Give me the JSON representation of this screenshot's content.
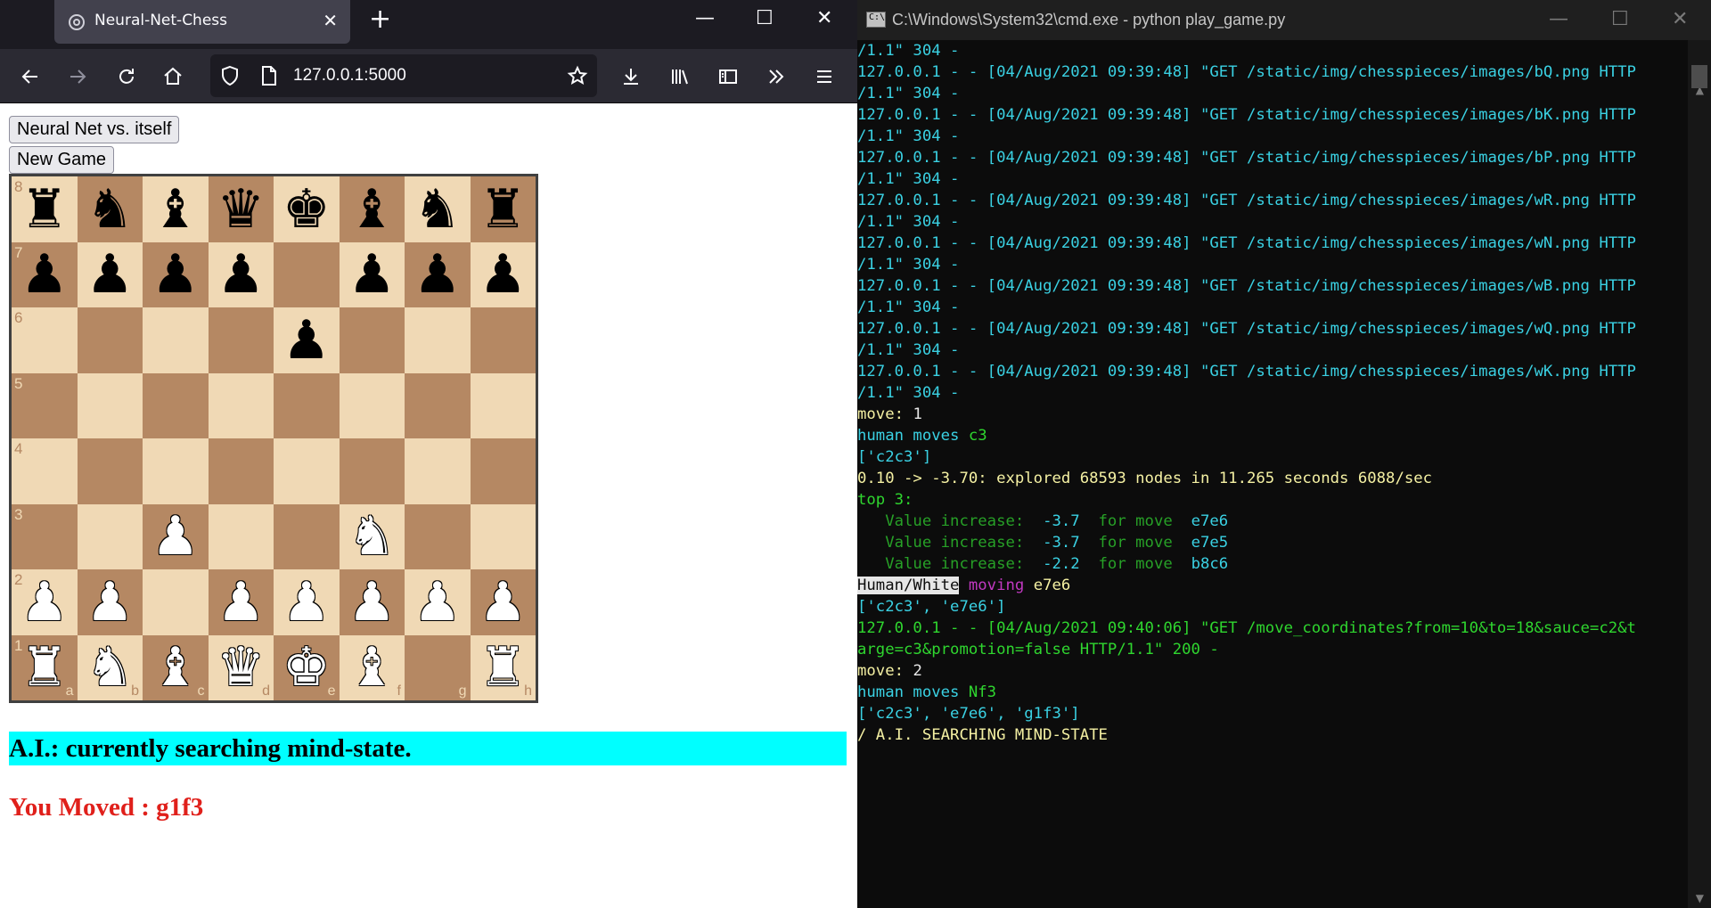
{
  "browser": {
    "tab_title": "Neural-Net-Chess",
    "url": "127.0.0.1:5000"
  },
  "page": {
    "button_self_play": "Neural Net vs. itself",
    "button_new_game": "New Game",
    "status": "A.I.: currently searching mind-state.",
    "moved": "You Moved : g1f3"
  },
  "board": {
    "ranks": [
      "8",
      "7",
      "6",
      "5",
      "4",
      "3",
      "2",
      "1"
    ],
    "files": [
      "a",
      "b",
      "c",
      "d",
      "e",
      "f",
      "g",
      "h"
    ],
    "rows": [
      [
        "bR",
        "bN",
        "bB",
        "bQ",
        "bK",
        "bB",
        "bN",
        "bR"
      ],
      [
        "bP",
        "bP",
        "bP",
        "bP",
        "",
        "bP",
        "bP",
        "bP"
      ],
      [
        "",
        "",
        "",
        "",
        "bP",
        "",
        "",
        ""
      ],
      [
        "",
        "",
        "",
        "",
        "",
        "",
        "",
        ""
      ],
      [
        "",
        "",
        "",
        "",
        "",
        "",
        "",
        ""
      ],
      [
        "",
        "",
        "wP",
        "",
        "",
        "wN",
        "",
        ""
      ],
      [
        "wP",
        "wP",
        "",
        "wP",
        "wP",
        "wP",
        "wP",
        "wP"
      ],
      [
        "wR",
        "wN",
        "wB",
        "wQ",
        "wK",
        "wB",
        "",
        "wR"
      ]
    ],
    "colors": {
      "light": "#f0d9b5",
      "dark": "#b58863"
    }
  },
  "terminal": {
    "title": "C:\\Windows\\System32\\cmd.exe - python  play_game.py",
    "lines": [
      [
        {
          "t": "/1.1\" 304 -",
          "c": "c-cyan"
        }
      ],
      [
        {
          "t": "127.0.0.1 - - [04/Aug/2021 09:39:48] \"GET /static/img/chesspieces/images/bQ.png HTTP",
          "c": "c-cyan"
        }
      ],
      [
        {
          "t": "/1.1\" 304 -",
          "c": "c-cyan"
        }
      ],
      [
        {
          "t": "127.0.0.1 - - [04/Aug/2021 09:39:48] \"GET /static/img/chesspieces/images/bK.png HTTP",
          "c": "c-cyan"
        }
      ],
      [
        {
          "t": "/1.1\" 304 -",
          "c": "c-cyan"
        }
      ],
      [
        {
          "t": "127.0.0.1 - - [04/Aug/2021 09:39:48] \"GET /static/img/chesspieces/images/bP.png HTTP",
          "c": "c-cyan"
        }
      ],
      [
        {
          "t": "/1.1\" 304 -",
          "c": "c-cyan"
        }
      ],
      [
        {
          "t": "127.0.0.1 - - [04/Aug/2021 09:39:48] \"GET /static/img/chesspieces/images/wR.png HTTP",
          "c": "c-cyan"
        }
      ],
      [
        {
          "t": "/1.1\" 304 -",
          "c": "c-cyan"
        }
      ],
      [
        {
          "t": "127.0.0.1 - - [04/Aug/2021 09:39:48] \"GET /static/img/chesspieces/images/wN.png HTTP",
          "c": "c-cyan"
        }
      ],
      [
        {
          "t": "/1.1\" 304 -",
          "c": "c-cyan"
        }
      ],
      [
        {
          "t": "127.0.0.1 - - [04/Aug/2021 09:39:48] \"GET /static/img/chesspieces/images/wB.png HTTP",
          "c": "c-cyan"
        }
      ],
      [
        {
          "t": "/1.1\" 304 -",
          "c": "c-cyan"
        }
      ],
      [
        {
          "t": "127.0.0.1 - - [04/Aug/2021 09:39:48] \"GET /static/img/chesspieces/images/wQ.png HTTP",
          "c": "c-cyan"
        }
      ],
      [
        {
          "t": "/1.1\" 304 -",
          "c": "c-cyan"
        }
      ],
      [
        {
          "t": "127.0.0.1 - - [04/Aug/2021 09:39:48] \"GET /static/img/chesspieces/images/wK.png HTTP",
          "c": "c-cyan"
        }
      ],
      [
        {
          "t": "/1.1\" 304 -",
          "c": "c-cyan"
        }
      ],
      [
        {
          "t": "move: ",
          "c": "c-yellow"
        },
        {
          "t": "1",
          "c": "c-white"
        }
      ],
      [
        {
          "t": "human moves ",
          "c": "c-cyan"
        },
        {
          "t": "c3",
          "c": "c-green"
        }
      ],
      [
        {
          "t": "['c2c3']",
          "c": "c-cyan"
        }
      ],
      [
        {
          "t": "0.10 -> -3.70: explored 68593 nodes in 11.265 seconds 6088/sec",
          "c": "c-yellow"
        }
      ],
      [
        {
          "t": "top 3:",
          "c": "c-green"
        }
      ],
      [
        {
          "t": "   Value increase:  ",
          "c": "c-dkgreen"
        },
        {
          "t": "-3.7",
          "c": "c-cyan"
        },
        {
          "t": "  for move  ",
          "c": "c-dkgreen"
        },
        {
          "t": "e7e6",
          "c": "c-cyan"
        }
      ],
      [
        {
          "t": "   Value increase:  ",
          "c": "c-dkgreen"
        },
        {
          "t": "-3.7",
          "c": "c-cyan"
        },
        {
          "t": "  for move  ",
          "c": "c-dkgreen"
        },
        {
          "t": "e7e5",
          "c": "c-cyan"
        }
      ],
      [
        {
          "t": "   Value increase:  ",
          "c": "c-dkgreen"
        },
        {
          "t": "-2.2",
          "c": "c-cyan"
        },
        {
          "t": "  for move  ",
          "c": "c-dkgreen"
        },
        {
          "t": "b8c6",
          "c": "c-cyan"
        }
      ],
      [
        {
          "t": "Human/White",
          "c": "c-inv"
        },
        {
          "t": " moving ",
          "c": "c-magenta"
        },
        {
          "t": "e7e6",
          "c": "c-yellow"
        }
      ],
      [
        {
          "t": "['c2c3', 'e7e6']",
          "c": "c-cyan"
        }
      ],
      [
        {
          "t": "127.0.0.1 - - [04/Aug/2021 09:40:06] \"GET /move_coordinates?from=10&to=18&sauce=c2&t",
          "c": "c-green"
        }
      ],
      [
        {
          "t": "arge=c3&promotion=false HTTP/1.1\" 200 -",
          "c": "c-green"
        }
      ],
      [
        {
          "t": "move: ",
          "c": "c-yellow"
        },
        {
          "t": "2",
          "c": "c-white"
        }
      ],
      [
        {
          "t": "human moves ",
          "c": "c-cyan"
        },
        {
          "t": "Nf3",
          "c": "c-green"
        }
      ],
      [
        {
          "t": "['c2c3', 'e7e6', 'g1f3']",
          "c": "c-cyan"
        }
      ],
      [
        {
          "t": "/ A.I. SEARCHING MIND-STATE",
          "c": "c-yellow"
        }
      ]
    ]
  }
}
